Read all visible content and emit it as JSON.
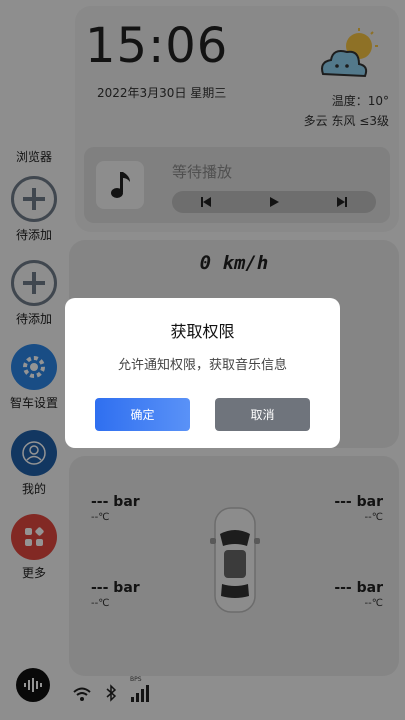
{
  "sidebar": {
    "browser_label": "浏览器",
    "items": [
      {
        "label": "待添加",
        "icon": "plus-circle-icon"
      },
      {
        "label": "待添加",
        "icon": "plus-circle-icon"
      },
      {
        "label": "智车设置",
        "icon": "gear-icon"
      },
      {
        "label": "我的",
        "icon": "user-icon"
      },
      {
        "label": "更多",
        "icon": "apps-grid-icon"
      }
    ]
  },
  "time_card": {
    "clock": "15:06",
    "date": "2022年3月30日   星期三",
    "temperature": "温度：10°",
    "condition": "多云  东风  ≤3级",
    "weather_icon": "cloud-sun-icon"
  },
  "music": {
    "title": "等待播放",
    "icon": "music-note-icon",
    "controls": [
      "prev-icon",
      "play-icon",
      "next-icon"
    ]
  },
  "speed": {
    "value": "0 km/h"
  },
  "tires": {
    "front_left": {
      "pressure": "--- bar",
      "temp": "--℃"
    },
    "front_right": {
      "pressure": "--- bar",
      "temp": "--℃"
    },
    "rear_left": {
      "pressure": "--- bar",
      "temp": "--℃"
    },
    "rear_right": {
      "pressure": "--- bar",
      "temp": "--℃"
    }
  },
  "status": {
    "icons": [
      "wifi-icon",
      "bluetooth-icon",
      "signal-icon"
    ],
    "signal_label": "BPS"
  },
  "dialog": {
    "title": "获取权限",
    "message": "允许通知权限，获取音乐信息",
    "confirm": "确定",
    "cancel": "取消"
  },
  "colors": {
    "confirm_blue": "#2f6ff0",
    "cancel_gray": "#6f747c",
    "settings_blue": "#2b86e6",
    "profile_blue": "#1f5fa8",
    "more_red": "#e0483e"
  }
}
